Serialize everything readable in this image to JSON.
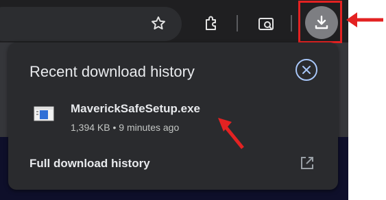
{
  "toolbar": {
    "icons": [
      "star-icon",
      "extensions-icon",
      "tab-search-icon",
      "download-icon"
    ]
  },
  "download_panel": {
    "title": "Recent download history",
    "close_icon": "close-circle-icon",
    "items": [
      {
        "file_name": "MaverickSafeSetup.exe",
        "meta": "1,394 KB • 9 minutes ago",
        "icon": "exe-file-icon"
      }
    ],
    "full_history_label": "Full download history",
    "open_icon": "open-external-icon"
  },
  "colors": {
    "annotation": "#e32222",
    "panel_bg": "#2a2b2e",
    "close_ring": "#a8c7fa"
  }
}
